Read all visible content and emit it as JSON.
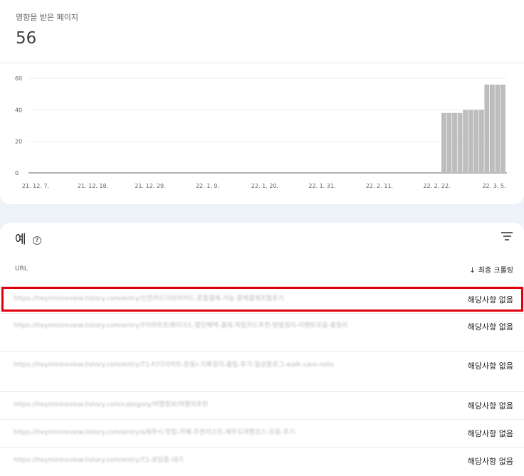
{
  "metric": {
    "label": "영향을 받은 페이지",
    "value": "56"
  },
  "chart_data": {
    "type": "bar",
    "x_tick_labels": [
      "21. 12. 7.",
      "21. 12. 18.",
      "21. 12. 29.",
      "22. 1. 9.",
      "22. 1. 20.",
      "22. 1. 31.",
      "22. 2. 11.",
      "22. 2. 22.",
      "22. 3. 5."
    ],
    "y_ticks": [
      0,
      20,
      40,
      60
    ],
    "ylim": [
      0,
      60
    ],
    "x": [
      "22. 2. 22.",
      "22. 2. 23.",
      "22. 2. 24.",
      "22. 2. 25.",
      "22. 2. 26.",
      "22. 2. 27.",
      "22. 2. 28.",
      "22. 3. 1.",
      "22. 3. 2.",
      "22. 3. 3.",
      "22. 3. 4.",
      "22. 3. 5."
    ],
    "values": [
      38,
      38,
      38,
      38,
      40,
      40,
      40,
      40,
      56,
      56,
      56,
      56
    ],
    "bar_color": "#bdbdbd",
    "grid": true
  },
  "examples": {
    "title": "예",
    "help_icon": "?",
    "col_url": "URL",
    "col_crawl": "최종 크롤링",
    "rows": [
      {
        "url": "https://heyminireview.tistory.com/entry/신한카드더모아카드-혼합결제-가능-함께결제조합후기",
        "status": "해당사항 없음"
      },
      {
        "url": "https://heyminireview.tistory.com/entry/T이마트트레이더스-할인혜택-결제-적립카드추천-방법정리-이벤트모음-총정리",
        "status": "해당사항 없음"
      },
      {
        "url": "https://heyminireview.tistory.com/entry/T1-F(다이어트-운동)-기록정리-꿀팁-후기-일상블로그-walk-care-note",
        "status": "해당사항 없음"
      },
      {
        "url": "https://heyminireview.tistory.com/category/여행정보/여행지추천",
        "status": "해당사항 없음"
      },
      {
        "url": "https://heyminireview.tistory.com/entry/a제주시-맛집-카페-추천리스트-제주도여행코스-모음-후기",
        "status": "해당사항 없음"
      },
      {
        "url": "https://heyminireview.tistory.com/entry/T1-로딩중-대기",
        "status": "해당사항 없음"
      }
    ]
  }
}
